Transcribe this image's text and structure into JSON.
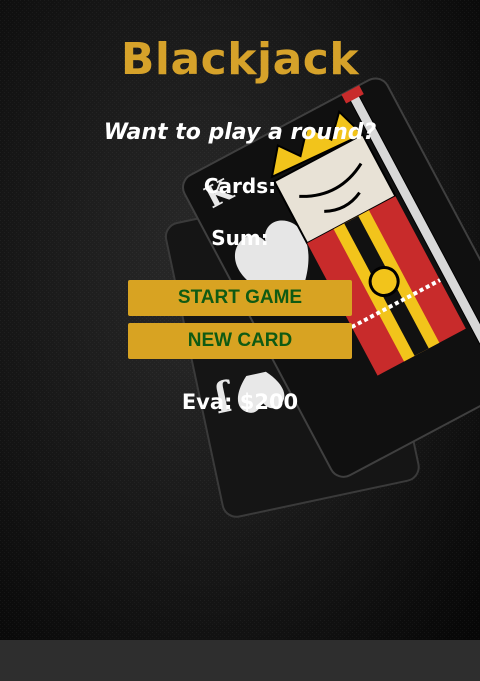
{
  "title": "Blackjack",
  "message": "Want to play a round?",
  "cards_label": "Cards:",
  "sum_label": "Sum:",
  "buttons": {
    "start_game": "START GAME",
    "new_card": "NEW CARD"
  },
  "player": {
    "text": "Eva: $200"
  },
  "colors": {
    "title": "#d6a22a",
    "button_bg": "#d8a322",
    "button_text": "#0f5a13",
    "text": "#ffffff",
    "background": "#0d0d0d"
  },
  "background_art": {
    "description_icon": "king-of-spades-card-icon",
    "secondary_icon": "jack-of-spades-card-icon"
  }
}
